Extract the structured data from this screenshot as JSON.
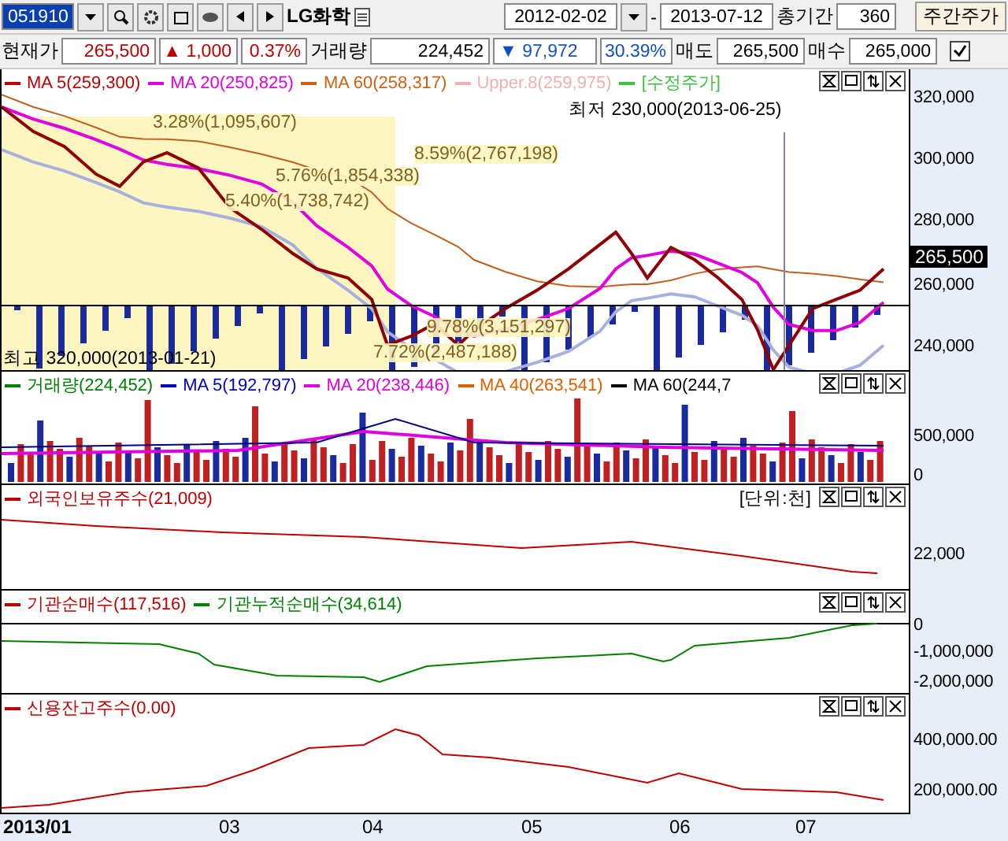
{
  "toolbar": {
    "code": "051910",
    "name": "LG화학",
    "date_from": "2012-02-02",
    "separator": "-",
    "date_to": "2013-07-12",
    "period_label": "총기간",
    "period_value": "360",
    "weekly_button": "주간주가"
  },
  "quote": {
    "price_label": "현재가",
    "price": "265,500",
    "change_mark": "▲",
    "change": "1,000",
    "change_pct": "0.37%",
    "volume_label": "거래량",
    "volume": "224,452",
    "vol_mark": "▼",
    "vol_change": "97,972",
    "vol_pct": "30.39%",
    "sell_label": "매도",
    "sell": "265,500",
    "buy_label": "매수",
    "buy": "265,000",
    "checked": true
  },
  "panels": [
    {
      "kind": "price",
      "legend": [
        {
          "label": "MA 5(259,300)",
          "color": "#c00000"
        },
        {
          "label": "MA 20(250,825)",
          "color": "#e000e0"
        },
        {
          "label": "MA 60(258,317)",
          "color": "#d06010"
        },
        {
          "label": "Upper.8(259,975)",
          "color": "#f0b0b0"
        },
        {
          "label": "[수정주가]",
          "color": "#40c040"
        }
      ],
      "y_labels": [
        "320,000",
        "300,000",
        "280,000",
        "260,000",
        "240,000"
      ],
      "price_tag": "265,500",
      "low_text": "최저 230,000(2013-06-25)",
      "high_text": "최고 320,000(2013-01-21)",
      "profile": [
        "3.28%(1,095,607)",
        "8.59%(2,767,198)",
        "5.76%(1,854,338)",
        "5.40%(1,738,742)",
        "9.78%(3,151,297)",
        "7.72%(2,487,188)"
      ]
    },
    {
      "kind": "volume",
      "legend": [
        {
          "label": "거래량(224,452)",
          "color": "#008000"
        },
        {
          "label": "MA 5(192,797)",
          "color": "#0000c0"
        },
        {
          "label": "MA 20(238,446)",
          "color": "#e000e0"
        },
        {
          "label": "MA 40(263,541)",
          "color": "#e06000"
        },
        {
          "label": "MA 60(244,7",
          "color": "#000000"
        }
      ],
      "y_labels": [
        "500,000",
        "0"
      ]
    },
    {
      "kind": "foreign",
      "legend": [
        {
          "label": "외국인보유주수(21,009)",
          "color": "#c00000"
        }
      ],
      "unit": "[단위:천]",
      "y_labels": [
        "22,000"
      ]
    },
    {
      "kind": "institution",
      "legend": [
        {
          "label": "기관순매수(117,516)",
          "color": "#c00000"
        },
        {
          "label": "기관누적순매수(34,614)",
          "color": "#008000"
        }
      ],
      "y_labels": [
        "0",
        "-1,000,000",
        "-2,000,000"
      ]
    },
    {
      "kind": "credit",
      "legend": [
        {
          "label": "신용잔고주수(0.00)",
          "color": "#c00000"
        }
      ],
      "y_labels": [
        "400,000.00",
        "200,000.00"
      ]
    }
  ],
  "x_labels": [
    "2013/01",
    "03",
    "04",
    "05",
    "06",
    "07"
  ]
}
